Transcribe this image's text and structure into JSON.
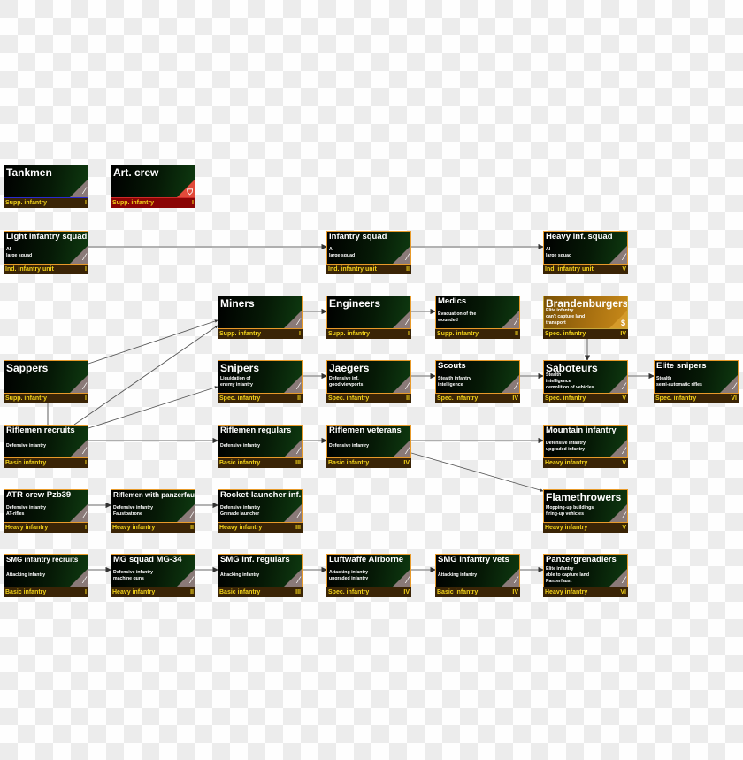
{
  "diagram_title": "",
  "theme": {
    "border_default": "#e89a2a",
    "border_blue": "#2a2ad0",
    "border_red": "#d02a2a",
    "footer_default": "#3a2406",
    "footer_red": "#8a0404",
    "footer_text": "#f2d21a"
  },
  "units": [
    {
      "id": "tankmen",
      "title": "Tankmen",
      "desc": "",
      "category": "Supp. infantry",
      "tier": "I",
      "style": "blue",
      "size": "big",
      "icon": "rifle-icon",
      "col": 0,
      "row": 0
    },
    {
      "id": "art-crew",
      "title": "Art. crew",
      "desc": "",
      "category": "Supp. infantry",
      "tier": "I",
      "style": "red",
      "size": "big",
      "icon": "shield-icon",
      "col": 1,
      "row": 0
    },
    {
      "id": "light-infantry-squad",
      "title": "Light infantry squad",
      "desc": "AI\nlarge squad",
      "category": "Ind. infantry unit",
      "tier": "I",
      "style": "",
      "size": "mid",
      "icon": "rifle-icon",
      "col": 0,
      "row": 1
    },
    {
      "id": "infantry-squad",
      "title": "Infantry squad",
      "desc": "AI\nlarge squad",
      "category": "Ind. infantry unit",
      "tier": "II",
      "style": "",
      "size": "mid",
      "icon": "rifle-icon",
      "col": 3,
      "row": 1
    },
    {
      "id": "heavy-inf-squad",
      "title": "Heavy inf. squad",
      "desc": "AI\nlarge squad",
      "category": "Ind. infantry unit",
      "tier": "V",
      "style": "",
      "size": "mid",
      "icon": "rifle-icon",
      "col": 5,
      "row": 1
    },
    {
      "id": "miners",
      "title": "Miners",
      "desc": "",
      "category": "Supp. infantry",
      "tier": "I",
      "style": "",
      "size": "big",
      "icon": "rifle-icon",
      "col": 2,
      "row": 2
    },
    {
      "id": "engineers",
      "title": "Engineers",
      "desc": "",
      "category": "Supp. infantry",
      "tier": "I",
      "style": "",
      "size": "big",
      "icon": "rifle-icon",
      "col": 3,
      "row": 2
    },
    {
      "id": "medics",
      "title": "Medics",
      "desc": "Evacuation of the\nwounded",
      "category": "Supp. infantry",
      "tier": "II",
      "style": "",
      "size": "mid",
      "icon": "rifle-icon",
      "col": 4,
      "row": 2
    },
    {
      "id": "brandenburgers",
      "title": "Brandenburgers",
      "desc": "Elite infantry\ncan't capture land\ntransport",
      "category": "Spec. infantry",
      "tier": "IV",
      "style": "gold",
      "size": "big",
      "icon": "dollar-icon",
      "col": 5,
      "row": 2
    },
    {
      "id": "sappers",
      "title": "Sappers",
      "desc": "",
      "category": "Supp. infantry",
      "tier": "I",
      "style": "",
      "size": "big",
      "icon": "rifle-icon",
      "col": 0,
      "row": 3
    },
    {
      "id": "snipers",
      "title": "Snipers",
      "desc": "Liquidation of\nenemy infantry",
      "category": "Spec. infantry",
      "tier": "II",
      "style": "",
      "size": "big",
      "icon": "rifle-icon",
      "col": 2,
      "row": 3
    },
    {
      "id": "jaegers",
      "title": "Jaegers",
      "desc": "Defensive inf.\ngood viewports",
      "category": "Spec. infantry",
      "tier": "II",
      "style": "",
      "size": "big",
      "icon": "rifle-icon",
      "col": 3,
      "row": 3
    },
    {
      "id": "scouts",
      "title": "Scouts",
      "desc": "Stealth infantry\nintelligence",
      "category": "Spec. infantry",
      "tier": "IV",
      "style": "",
      "size": "mid",
      "icon": "rifle-icon",
      "col": 4,
      "row": 3
    },
    {
      "id": "saboteurs",
      "title": "Saboteurs",
      "desc": "Stealth\nintelligence\ndemolition of vehicles",
      "category": "Spec. infantry",
      "tier": "V",
      "style": "",
      "size": "big",
      "icon": "rifle-icon",
      "col": 5,
      "row": 3
    },
    {
      "id": "elite-snipers",
      "title": "Elite snipers",
      "desc": "Stealth\nsemi-automatic rifles",
      "category": "Spec. infantry",
      "tier": "VI",
      "style": "",
      "size": "mid",
      "icon": "rifle-icon",
      "col": 6,
      "row": 3
    },
    {
      "id": "riflemen-recruits",
      "title": "Riflemen recruits",
      "desc": "Defensive infantry",
      "category": "Basic infantry",
      "tier": "I",
      "style": "",
      "size": "mid",
      "icon": "rifle-icon",
      "col": 0,
      "row": 4
    },
    {
      "id": "riflemen-regulars",
      "title": "Riflemen regulars",
      "desc": "Defensive infantry",
      "category": "Basic infantry",
      "tier": "III",
      "style": "",
      "size": "mid",
      "icon": "rifle-icon",
      "col": 2,
      "row": 4
    },
    {
      "id": "riflemen-veterans",
      "title": "Riflemen veterans",
      "desc": "Defensive infantry",
      "category": "Basic infantry",
      "tier": "IV",
      "style": "",
      "size": "mid",
      "icon": "rifle-icon",
      "col": 3,
      "row": 4
    },
    {
      "id": "mountain-infantry",
      "title": "Mountain infantry",
      "desc": "Defensive infantry\nupgraded infantry",
      "category": "Heavy infantry",
      "tier": "V",
      "style": "",
      "size": "mid",
      "icon": "rifle-icon",
      "col": 5,
      "row": 4
    },
    {
      "id": "atr-crew-pzb39",
      "title": "ATR crew Pzb39",
      "desc": "Defensive infantry\nAT-rifles",
      "category": "Heavy infantry",
      "tier": "I",
      "style": "",
      "size": "mid",
      "icon": "rifle-icon",
      "col": 0,
      "row": 5
    },
    {
      "id": "riflemen-with-panzerfaust",
      "title": "Riflemen with panzerfaust",
      "desc": "Defensive infantry\nFaustpatrone",
      "category": "Heavy infantry",
      "tier": "II",
      "style": "",
      "size": "small",
      "icon": "rifle-icon",
      "col": 1,
      "row": 5
    },
    {
      "id": "rocket-launcher-inf",
      "title": "Rocket-launcher inf.",
      "desc": "Defensive infantry\nGrenade launcher",
      "category": "Heavy infantry",
      "tier": "III",
      "style": "",
      "size": "mid",
      "icon": "rifle-icon",
      "col": 2,
      "row": 5
    },
    {
      "id": "flamethrowers",
      "title": "Flamethrowers",
      "desc": "Mopping-up buildings\nfiring-up vehicles",
      "category": "Heavy infantry",
      "tier": "V",
      "style": "",
      "size": "big",
      "icon": "rifle-icon",
      "col": 5,
      "row": 5
    },
    {
      "id": "smg-infantry-recruits",
      "title": "SMG infantry recruits",
      "desc": "Attacking infantry",
      "category": "Basic infantry",
      "tier": "I",
      "style": "",
      "size": "small",
      "icon": "rifle-icon",
      "col": 0,
      "row": 6
    },
    {
      "id": "mg-squad-mg34",
      "title": "MG squad MG-34",
      "desc": "Defensive infantry\nmachine guns",
      "category": "Heavy infantry",
      "tier": "II",
      "style": "",
      "size": "mid",
      "icon": "rifle-icon",
      "col": 1,
      "row": 6
    },
    {
      "id": "smg-inf-regulars",
      "title": "SMG inf. regulars",
      "desc": "Attacking infantry",
      "category": "Basic infantry",
      "tier": "III",
      "style": "",
      "size": "mid",
      "icon": "rifle-icon",
      "col": 2,
      "row": 6
    },
    {
      "id": "luftwaffe-airborne",
      "title": "Luftwaffe Airborne",
      "desc": "Attacking infantry\nupgraded infantry",
      "category": "Spec. infantry",
      "tier": "IV",
      "style": "",
      "size": "mid",
      "icon": "rifle-icon",
      "col": 3,
      "row": 6
    },
    {
      "id": "smg-infantry-vets",
      "title": "SMG infantry vets",
      "desc": "Attacking infantry",
      "category": "Basic infantry",
      "tier": "IV",
      "style": "",
      "size": "mid",
      "icon": "rifle-icon",
      "col": 4,
      "row": 6
    },
    {
      "id": "panzergrenadiers",
      "title": "Panzergrenadiers",
      "desc": "Elite infantry\nable to capture land\nPanzerfaust",
      "category": "Heavy infantry",
      "tier": "VI",
      "style": "",
      "size": "mid",
      "icon": "rifle-icon",
      "col": 5,
      "row": 6
    }
  ],
  "connections": [
    {
      "from": "light-infantry-squad",
      "to": "infantry-squad"
    },
    {
      "from": "infantry-squad",
      "to": "heavy-inf-squad"
    },
    {
      "from": "miners",
      "to": "engineers"
    },
    {
      "from": "engineers",
      "to": "medics"
    },
    {
      "from": "sappers",
      "to": "miners"
    },
    {
      "from": "riflemen-recruits",
      "to": "miners"
    },
    {
      "from": "riflemen-recruits",
      "to": "snipers"
    },
    {
      "from": "riflemen-recruits",
      "to": "sappers"
    },
    {
      "from": "snipers",
      "to": "jaegers"
    },
    {
      "from": "jaegers",
      "to": "scouts"
    },
    {
      "from": "scouts",
      "to": "saboteurs"
    },
    {
      "from": "brandenburgers",
      "to": "saboteurs"
    },
    {
      "from": "saboteurs",
      "to": "elite-snipers"
    },
    {
      "from": "riflemen-recruits",
      "to": "riflemen-regulars"
    },
    {
      "from": "riflemen-regulars",
      "to": "riflemen-veterans"
    },
    {
      "from": "riflemen-veterans",
      "to": "mountain-infantry"
    },
    {
      "from": "riflemen-veterans",
      "to": "flamethrowers"
    },
    {
      "from": "atr-crew-pzb39",
      "to": "riflemen-with-panzerfaust"
    },
    {
      "from": "riflemen-with-panzerfaust",
      "to": "rocket-launcher-inf"
    },
    {
      "from": "smg-infantry-recruits",
      "to": "mg-squad-mg34"
    },
    {
      "from": "mg-squad-mg34",
      "to": "smg-inf-regulars"
    },
    {
      "from": "smg-inf-regulars",
      "to": "luftwaffe-airborne"
    },
    {
      "from": "luftwaffe-airborne",
      "to": "smg-infantry-vets"
    },
    {
      "from": "smg-infantry-vets",
      "to": "panzergrenadiers"
    }
  ]
}
